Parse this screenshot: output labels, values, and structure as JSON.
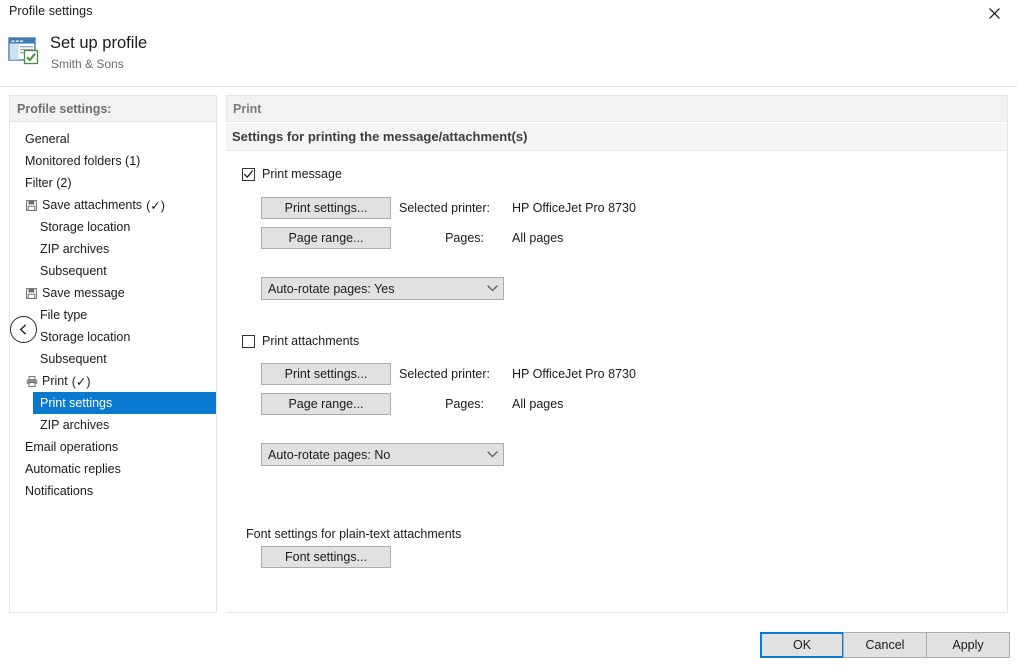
{
  "window": {
    "title": "Profile settings",
    "close_icon": "close-icon"
  },
  "header": {
    "title": "Set up profile",
    "subtitle": "Smith & Sons",
    "icon": "profile-setup-icon"
  },
  "sidebar": {
    "heading": "Profile settings:",
    "collapse_icon": "chevron-left-icon",
    "items": [
      {
        "label": "General",
        "level": 1,
        "icon": null,
        "suffix": "",
        "selected": false
      },
      {
        "label": "Monitored folders (1)",
        "level": 1,
        "icon": null,
        "suffix": "",
        "selected": false
      },
      {
        "label": "Filter (2)",
        "level": 1,
        "icon": null,
        "suffix": "",
        "selected": false
      },
      {
        "label": "Save attachments",
        "level": 1,
        "icon": "save-icon",
        "suffix": "(✓)",
        "selected": false
      },
      {
        "label": "Storage location",
        "level": 2,
        "icon": null,
        "suffix": "",
        "selected": false
      },
      {
        "label": "ZIP archives",
        "level": 2,
        "icon": null,
        "suffix": "",
        "selected": false
      },
      {
        "label": "Subsequent",
        "level": 2,
        "icon": null,
        "suffix": "",
        "selected": false
      },
      {
        "label": "Save message",
        "level": 1,
        "icon": "save-icon",
        "suffix": "",
        "selected": false
      },
      {
        "label": "File type",
        "level": 2,
        "icon": null,
        "suffix": "",
        "selected": false
      },
      {
        "label": "Storage location",
        "level": 2,
        "icon": null,
        "suffix": "",
        "selected": false
      },
      {
        "label": "Subsequent",
        "level": 2,
        "icon": null,
        "suffix": "",
        "selected": false
      },
      {
        "label": "Print",
        "level": 1,
        "icon": "printer-icon",
        "suffix": "(✓)",
        "selected": false
      },
      {
        "label": "Print settings",
        "level": 2,
        "icon": null,
        "suffix": "",
        "selected": true
      },
      {
        "label": "ZIP archives",
        "level": 2,
        "icon": null,
        "suffix": "",
        "selected": false
      },
      {
        "label": "Email operations",
        "level": 1,
        "icon": null,
        "suffix": "",
        "selected": false
      },
      {
        "label": "Automatic replies",
        "level": 1,
        "icon": null,
        "suffix": "",
        "selected": false
      },
      {
        "label": "Notifications",
        "level": 1,
        "icon": null,
        "suffix": "",
        "selected": false
      }
    ]
  },
  "content": {
    "band_title": "Print",
    "band_subtitle": "Settings for printing the message/attachment(s)",
    "message_section": {
      "checkbox_label": "Print message",
      "checked": true,
      "print_settings_button": "Print settings...",
      "page_range_button": "Page range...",
      "printer_label": "Selected printer:",
      "printer_value": "HP OfficeJet Pro 8730",
      "pages_label": "Pages:",
      "pages_value": "All pages",
      "combo_value": "Auto-rotate pages: Yes",
      "combo_arrow_icon": "chevron-down-icon"
    },
    "attachments_section": {
      "checkbox_label": "Print attachments",
      "checked": false,
      "print_settings_button": "Print settings...",
      "page_range_button": "Page range...",
      "printer_label": "Selected printer:",
      "printer_value": "HP OfficeJet Pro 8730",
      "pages_label": "Pages:",
      "pages_value": "All pages",
      "combo_value": "Auto-rotate pages: No",
      "combo_arrow_icon": "chevron-down-icon"
    },
    "font_section": {
      "heading": "Font settings for plain-text attachments",
      "button": "Font settings..."
    }
  },
  "footer": {
    "ok": "OK",
    "cancel": "Cancel",
    "apply": "Apply"
  },
  "colors": {
    "accent": "#0a7ad1",
    "band": "#f2f2f2",
    "button_face": "#e1e1e1",
    "button_border": "#adadad"
  }
}
